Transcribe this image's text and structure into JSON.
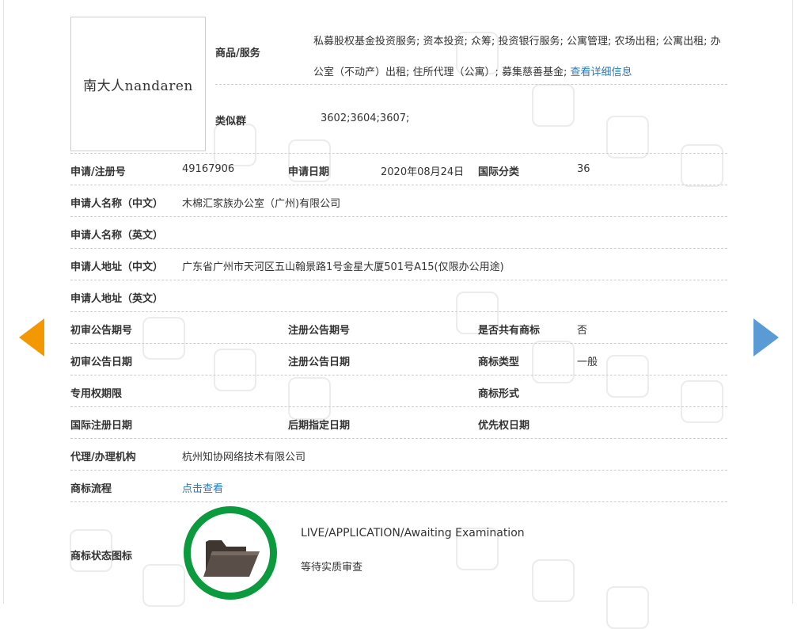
{
  "trademark": {
    "logo_text": "南大人nandaren",
    "goods_label": "商品/服务",
    "goods_text": "私募股权基金投资服务; 资本投资; 众筹; 投资银行服务; 公寓管理; 农场出租; 公寓出租; 办公室（不动产）出租; 住所代理（公寓）; 募集慈善基金;",
    "goods_more_link": "查看详细信息",
    "similar_label": "类似群",
    "similar_value": "3602;3604;3607;"
  },
  "rows": {
    "reg_no_label": "申请/注册号",
    "reg_no_value": "49167906",
    "app_date_label": "申请日期",
    "app_date_value": "2020年08月24日",
    "intl_class_label": "国际分类",
    "intl_class_value": "36",
    "applicant_cn_label": "申请人名称（中文）",
    "applicant_cn_value": "木棉汇家族办公室（广州)有限公司",
    "applicant_en_label": "申请人名称（英文）",
    "address_cn_label": "申请人地址（中文）",
    "address_cn_value": "广东省广州市天河区五山翰景路1号金星大厦501号A15(仅限办公用途)",
    "address_en_label": "申请人地址（英文）",
    "prelim_no_label": "初审公告期号",
    "reg_pub_no_label": "注册公告期号",
    "shared_label": "是否共有商标",
    "shared_value": "否",
    "prelim_date_label": "初审公告日期",
    "reg_pub_date_label": "注册公告日期",
    "tm_type_label": "商标类型",
    "tm_type_value": "一般",
    "exclusive_label": "专用权期限",
    "tm_form_label": "商标形式",
    "intl_reg_date_label": "国际注册日期",
    "later_date_label": "后期指定日期",
    "priority_label": "优先权日期",
    "agent_label": "代理/办理机构",
    "agent_value": "杭州知协网络技术有限公司",
    "flow_label": "商标流程",
    "flow_link": "点击查看",
    "status_icon_label": "商标状态图标",
    "status_en": "LIVE/APPLICATION/Awaiting Examination",
    "status_cn": "等待实质审查"
  },
  "colors": {
    "link": "#2a7ab8",
    "status_ring": "#0b9a3d",
    "arrow_left": "#f39800",
    "arrow_right": "#5b9bd5"
  },
  "icons": {
    "prev": "arrow-left-icon",
    "next": "arrow-right-icon",
    "status": "folder-icon"
  }
}
